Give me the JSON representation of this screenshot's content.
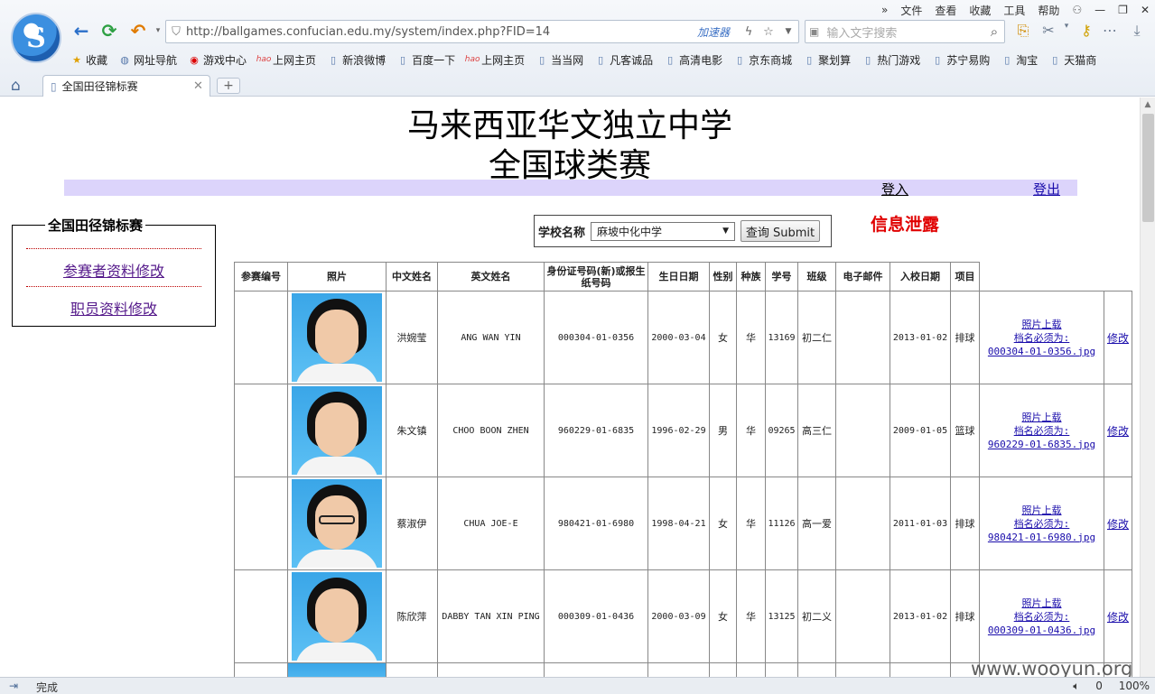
{
  "browser": {
    "menu": [
      "»",
      "文件",
      "查看",
      "收藏",
      "工具",
      "帮助"
    ],
    "url": "http://ballgames.confucian.edu.my/system/index.php?FID=14",
    "accelerator": "加速器",
    "search_placeholder": "输入文字搜索",
    "bookmarks": [
      "收藏",
      "网址导航",
      "游戏中心",
      "上网主页",
      "新浪微博",
      "百度一下",
      "上网主页",
      "当当网",
      "凡客诚品",
      "高清电影",
      "京东商城",
      "聚划算",
      "热门游戏",
      "苏宁易购",
      "淘宝",
      "天猫商"
    ],
    "tab_title": "全国田径锦标赛",
    "status": "完成",
    "zoom": "100%",
    "status_count": "0"
  },
  "page": {
    "title_line1": "马来西亚华文独立中学",
    "title_line2": "全国球类赛",
    "login": "登入",
    "logout": "登出",
    "sidebar": {
      "title": "全国田径锦标赛",
      "links": [
        "参赛者资料修改",
        "职员资料修改"
      ]
    },
    "school_label": "学校名称",
    "school_selected": "麻坡中化中学",
    "submit_label": "查询 Submit",
    "leak_label": "信息泄露",
    "table": {
      "headers": [
        "参赛编号",
        "照片",
        "中文姓名",
        "英文姓名",
        "身份证号码(新)或报生纸号码",
        "生日日期",
        "性别",
        "种族",
        "学号",
        "班级",
        "电子邮件",
        "入校日期",
        "项目"
      ],
      "upload_label": "照片上载",
      "filename_label": "档名必须为:",
      "edit_label": "修改",
      "rows": [
        {
          "cn": "洪婉莹",
          "en": "ANG WAN YIN",
          "ic": "000304-01-0356",
          "dob": "2000-03-04",
          "sex": "女",
          "race": "华",
          "sid": "13169",
          "cls": "初二仁",
          "email": "",
          "join": "2013-01-02",
          "sport": "排球",
          "file": "000304-01-0356.jpg"
        },
        {
          "cn": "朱文镇",
          "en": "CHOO BOON ZHEN",
          "ic": "960229-01-6835",
          "dob": "1996-02-29",
          "sex": "男",
          "race": "华",
          "sid": "09265",
          "cls": "高三仁",
          "email": "",
          "join": "2009-01-05",
          "sport": "篮球",
          "file": "960229-01-6835.jpg"
        },
        {
          "cn": "蔡淑伊",
          "en": "CHUA JOE-E",
          "ic": "980421-01-6980",
          "dob": "1998-04-21",
          "sex": "女",
          "race": "华",
          "sid": "11126",
          "cls": "高一爱",
          "email": "",
          "join": "2011-01-03",
          "sport": "排球",
          "file": "980421-01-6980.jpg"
        },
        {
          "cn": "陈欣萍",
          "en": "DABBY TAN XIN PING",
          "ic": "000309-01-0436",
          "dob": "2000-03-09",
          "sex": "女",
          "race": "华",
          "sid": "13125",
          "cls": "初二义",
          "email": "",
          "join": "2013-01-02",
          "sport": "排球",
          "file": "000309-01-0436.jpg"
        }
      ]
    },
    "watermark": "www.wooyun.org"
  }
}
